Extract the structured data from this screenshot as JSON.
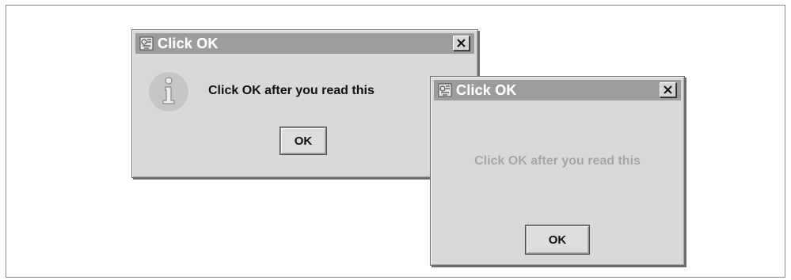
{
  "dialogs": [
    {
      "title": "Click OK",
      "message": "Click OK after you read this",
      "ok_label": "OK",
      "close_glyph": "×",
      "icon": "info-icon"
    },
    {
      "title": "Click OK",
      "message": "Click OK after you read this",
      "ok_label": "OK",
      "close_glyph": "×"
    }
  ],
  "colors": {
    "titlebar": "#9c9c9c",
    "dialog_bg": "#d9d9d9",
    "message_dim": "#a6a6a6"
  }
}
